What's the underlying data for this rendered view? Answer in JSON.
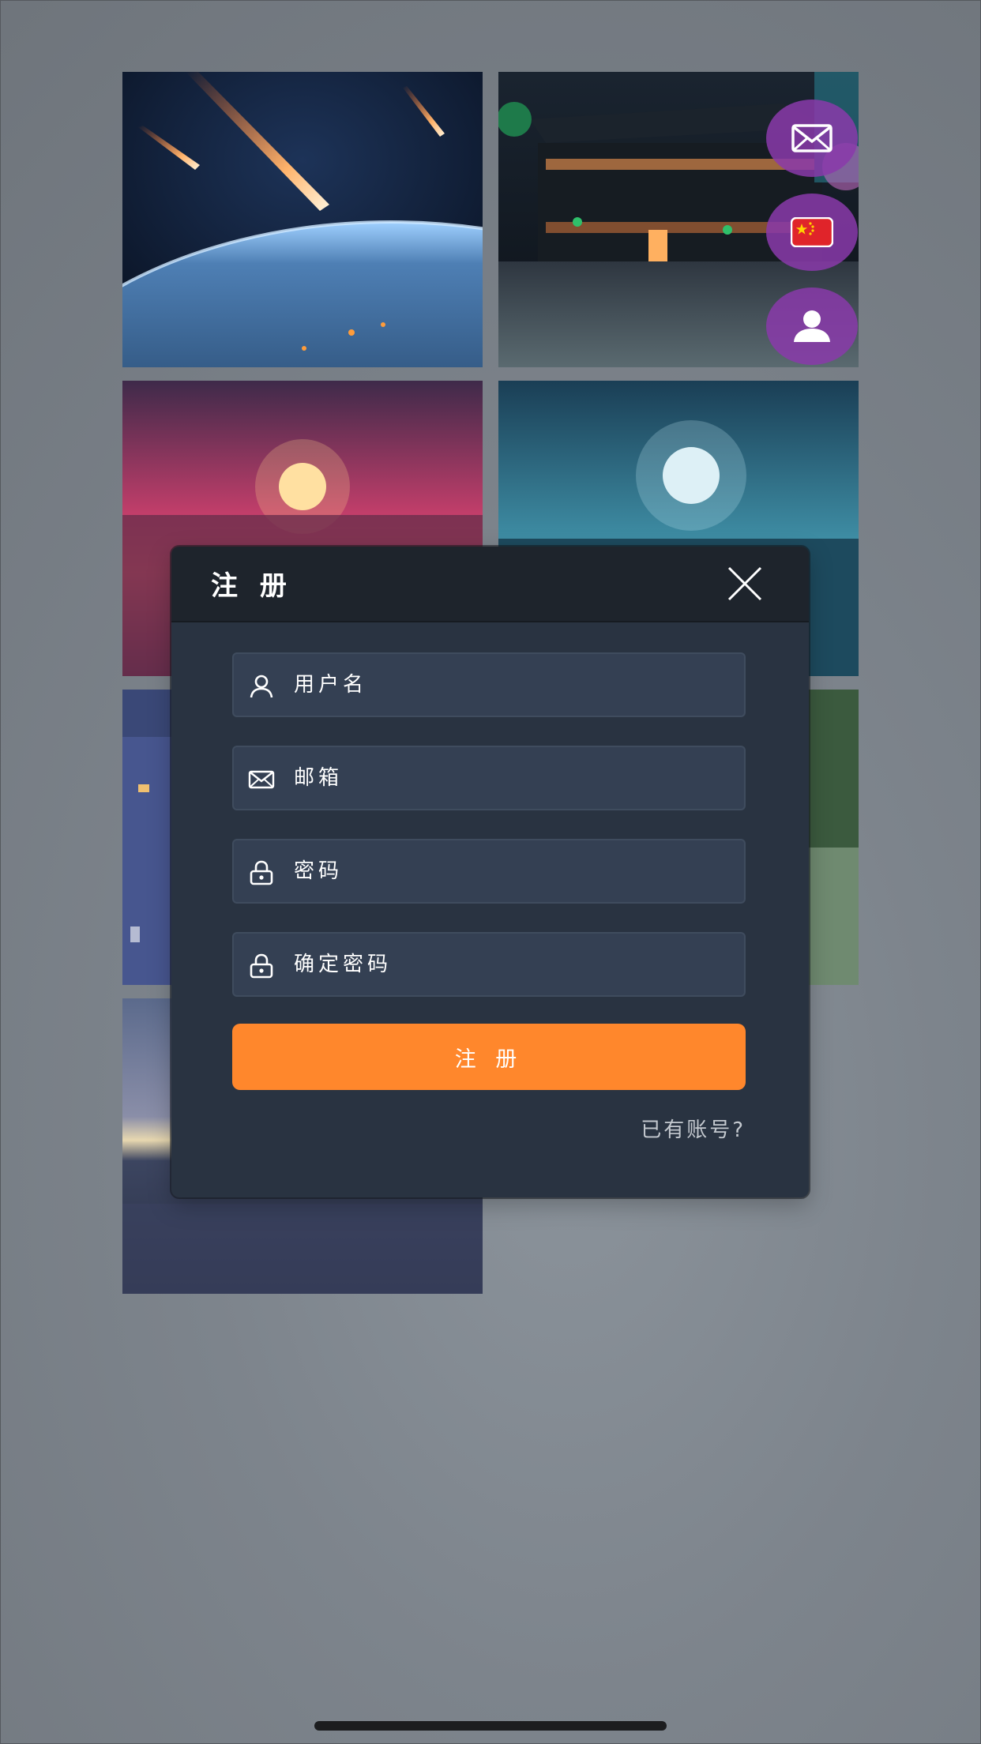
{
  "modal": {
    "title": "注 册",
    "fields": [
      {
        "placeholder": "用户名",
        "icon": "user-icon"
      },
      {
        "placeholder": "邮箱",
        "icon": "mail-icon"
      },
      {
        "placeholder": "密码",
        "icon": "lock-icon"
      },
      {
        "placeholder": "确定密码",
        "icon": "lock-icon"
      }
    ],
    "submit_label": "注 册",
    "login_link": "已有账号?"
  },
  "floating_actions": [
    {
      "icon": "mail-icon"
    },
    {
      "icon": "china-flag-icon"
    },
    {
      "icon": "user-profile-icon"
    }
  ],
  "gallery": [
    {
      "icon": "meteor-earth-image"
    },
    {
      "icon": "rainy-temple-image"
    },
    {
      "icon": "sunset-sea-image"
    },
    {
      "icon": "moon-ocean-image"
    },
    {
      "icon": "city-night-image"
    },
    {
      "icon": "forest-statue-image"
    },
    {
      "icon": "twilight-water-image"
    }
  ],
  "colors": {
    "accent": "#ff872c",
    "modal_bg": "#293341",
    "header_bg": "#1e242c",
    "input_bg": "#344053",
    "fab_bg": "#8a3aaa"
  }
}
